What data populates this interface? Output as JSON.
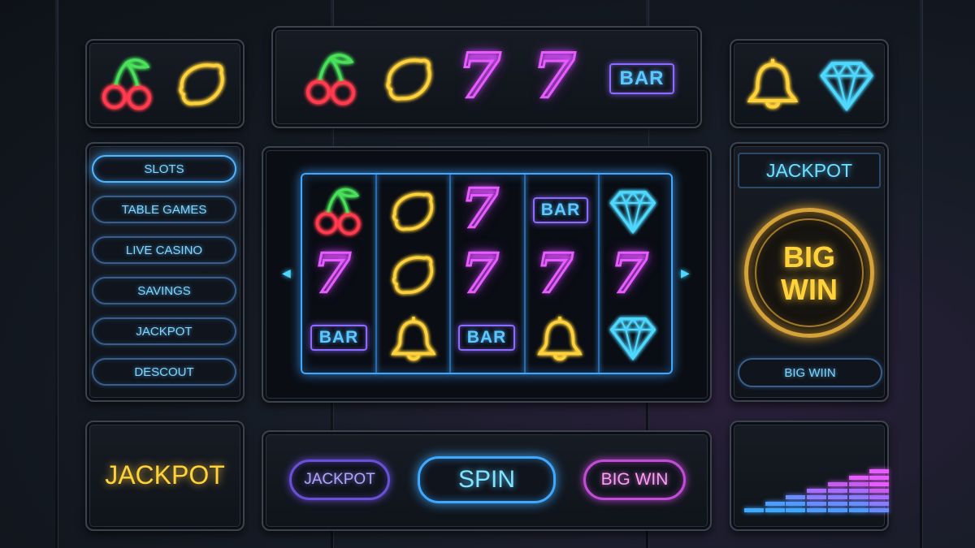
{
  "top_left_reel": {
    "symbols": [
      "cherry-icon",
      "lemon-icon"
    ]
  },
  "top_center_reel": {
    "symbols": [
      "cherry-icon",
      "lemon-icon",
      "seven-icon",
      "seven-icon",
      "bar-icon"
    ],
    "seven_glyph": "7",
    "bar_label": "BAR"
  },
  "top_right_reel": {
    "symbols": [
      "bell-icon",
      "diamond-icon"
    ]
  },
  "nav": {
    "items": [
      {
        "label": "SLOTS",
        "active": true
      },
      {
        "label": "TABLE GAMES",
        "active": false
      },
      {
        "label": "LIVE CASINO",
        "active": false
      },
      {
        "label": "SAVINGS",
        "active": false
      },
      {
        "label": "JACKPOT",
        "active": false
      },
      {
        "label": "DESCOUT",
        "active": false
      }
    ]
  },
  "reels": {
    "seven_glyph": "7",
    "bar_label": "BAR",
    "grid": [
      [
        "cherry-icon",
        "lemon-icon",
        "seven-icon",
        "bar-icon",
        "diamond-icon"
      ],
      [
        "seven-icon",
        "lemon-icon",
        "seven-icon",
        "seven-icon",
        "seven-icon"
      ],
      [
        "bar-icon",
        "bell-icon",
        "bar-icon",
        "bell-icon",
        "diamond-icon"
      ]
    ],
    "left_arrow": "◀",
    "right_arrow": "▶"
  },
  "jackpot_panel": {
    "title": "JACKPOT",
    "big_win_line1": "BIG",
    "big_win_line2": "WIN",
    "button_label": "BIG WIIN"
  },
  "bottom_left": {
    "label": "JACKPOT"
  },
  "controls": {
    "jackpot_label": "JACKPOT",
    "spin_label": "SPIN",
    "big_win_label": "BIG WIN"
  },
  "equalizer": {
    "levels": [
      1,
      2,
      3,
      4,
      5,
      6,
      7
    ]
  },
  "colors": {
    "cyan": "#4fd8ff",
    "magenta": "#e85cff",
    "yellow": "#ffd23a",
    "red": "#ff3b4e",
    "green": "#48e05a",
    "purple": "#8a6cff",
    "gold": "#e0a830"
  }
}
